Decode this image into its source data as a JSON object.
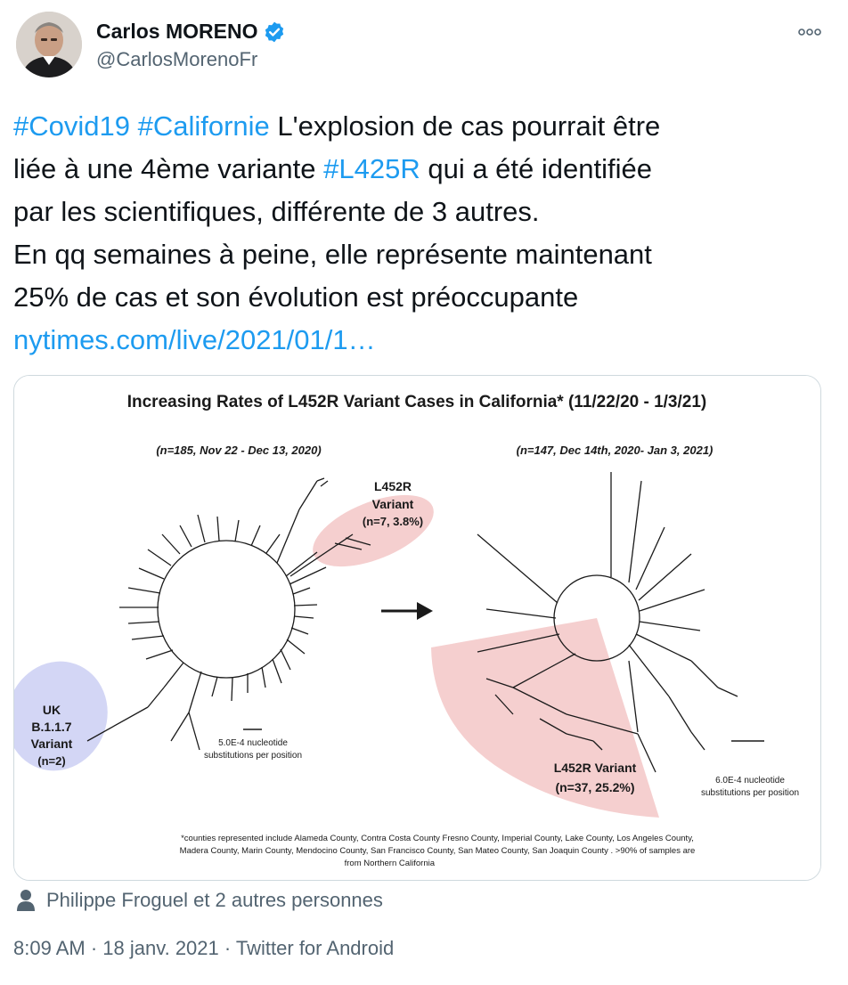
{
  "author": {
    "display_name": "Carlos MORENO",
    "handle": "@CarlosMorenoFr",
    "verified": true,
    "avatar_icon": "profile-photo",
    "verified_icon": "verified-badge-icon",
    "verified_color": "#1d9bf0"
  },
  "tweet": {
    "hashtag_covid": "#Covid19",
    "hashtag_california": "#Californie",
    "text_1a": " L'explosion de cas  pourrait être",
    "text_2a": "liée à une 4ème variante ",
    "hashtag_l425r": "#L425R",
    "text_2b": " qui a été identifiée",
    "text_3": "par les scientifiques, différente de 3 autres.",
    "text_4": "En qq semaines à peine, elle représente maintenant",
    "text_5": "25% de cas et son évolution est préoccupante",
    "link": "nytimes.com/live/2021/01/1…",
    "link_color": "#1d9bf0"
  },
  "media": {
    "title": "Increasing Rates of L452R Variant Cases in California* (11/22/20 - 1/3/21)",
    "left_panel": {
      "subtitle": "(n=185, Nov 22 - Dec 13, 2020)",
      "variant_label_1": "L452R",
      "variant_label_2": "Variant",
      "variant_count": "(n=7, 3.8%)",
      "uk_label_1": "UK",
      "uk_label_2": "B.1.1.7",
      "uk_label_3": "Variant",
      "uk_count": "(n=2)",
      "scale_1": "5.0E-4 nucleotide",
      "scale_2": "substitutions per position"
    },
    "right_panel": {
      "subtitle": "(n=147, Dec 14th, 2020- Jan 3, 2021)",
      "variant_label": "L452R Variant",
      "variant_count": "(n=37, 25.2%)",
      "scale_1": "6.0E-4 nucleotide",
      "scale_2": "substitutions per position"
    },
    "footnote_1": "*counties represented include Alameda County, Contra Costa County Fresno County, Imperial County, Lake County, Los Angeles County,",
    "footnote_2": "Madera County, Marin County, Mendocino County, San Francisco County, San Mateo County, San Joaquin County . >90% of samples are",
    "footnote_3": "from Northern California",
    "highlight_red": "#f5cfcf",
    "highlight_blue": "#d3d6f5"
  },
  "liked_by": {
    "icon": "person-icon",
    "text": "Philippe Froguel et 2 autres personnes"
  },
  "meta": {
    "time": "8:09 AM",
    "separator": " · ",
    "date": "18 janv. 2021",
    "source": "Twitter for Android"
  }
}
